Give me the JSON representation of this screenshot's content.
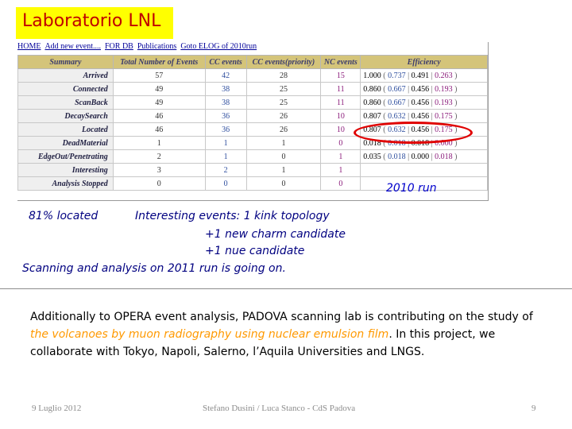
{
  "title": "Laboratorio LNL",
  "nav_links": [
    "HOME",
    "Add new event....",
    "FOR DB",
    "Publications",
    "Goto ELOG of 2010run"
  ],
  "table": {
    "headers": [
      "Summary",
      "Total Number of Events",
      "CC events",
      "CC events(priority)",
      "NC events",
      "Efficiency"
    ],
    "rows": [
      {
        "label": "Arrived",
        "total": "57",
        "cc": "42",
        "ccp": "28",
        "nc": "15",
        "eff_total": "1.000",
        "eff_cc": "0.737",
        "eff_ccp": "0.491",
        "eff_nc": "0.263"
      },
      {
        "label": "Connected",
        "total": "49",
        "cc": "38",
        "ccp": "25",
        "nc": "11",
        "eff_total": "0.860",
        "eff_cc": "0.667",
        "eff_ccp": "0.456",
        "eff_nc": "0.193"
      },
      {
        "label": "ScanBack",
        "total": "49",
        "cc": "38",
        "ccp": "25",
        "nc": "11",
        "eff_total": "0.860",
        "eff_cc": "0.667",
        "eff_ccp": "0.456",
        "eff_nc": "0.193"
      },
      {
        "label": "DecaySearch",
        "total": "46",
        "cc": "36",
        "ccp": "26",
        "nc": "10",
        "eff_total": "0.807",
        "eff_cc": "0.632",
        "eff_ccp": "0.456",
        "eff_nc": "0.175"
      },
      {
        "label": "Located",
        "total": "46",
        "cc": "36",
        "ccp": "26",
        "nc": "10",
        "eff_total": "0.807",
        "eff_cc": "0.632",
        "eff_ccp": "0.456",
        "eff_nc": "0.175"
      },
      {
        "label": "DeadMaterial",
        "total": "1",
        "cc": "1",
        "ccp": "1",
        "nc": "0",
        "eff_total": "0.018",
        "eff_cc": "0.018",
        "eff_ccp": "0.018",
        "eff_nc": "0.000"
      },
      {
        "label": "EdgeOut/Penetrating",
        "total": "2",
        "cc": "1",
        "ccp": "0",
        "nc": "1",
        "eff_total": "0.035",
        "eff_cc": "0.018",
        "eff_ccp": "0.000",
        "eff_nc": "0.018"
      },
      {
        "label": "Interesting",
        "total": "3",
        "cc": "2",
        "ccp": "1",
        "nc": "1",
        "eff_total": "",
        "eff_cc": "",
        "eff_ccp": "",
        "eff_nc": ""
      },
      {
        "label": "Analysis Stopped",
        "total": "0",
        "cc": "0",
        "ccp": "0",
        "nc": "0",
        "eff_total": "",
        "eff_cc": "",
        "eff_ccp": "",
        "eff_nc": ""
      }
    ]
  },
  "run_label": "2010 run",
  "located_note": "81% located",
  "interesting_lines": [
    "Interesting events: 1 kink topology",
    "+1 new charm candidate",
    "+1 nue candidate"
  ],
  "scanning_note": "Scanning and analysis on 2011 run is going on.",
  "paragraph": {
    "p1": "Additionally to OPERA event analysis, PADOVA scanning lab is contributing on the study of ",
    "highlight": "the volcanoes by muon radiography using nuclear emulsion film",
    "p2": ". In this project, we collaborate with Tokyo, Napoli, Salerno, l’Aquila Universities and LNGS."
  },
  "footer": {
    "date": "9 Luglio 2012",
    "authors": "Stefano Dusini / Luca Stanco - CdS Padova",
    "page": "9"
  },
  "colors": {
    "title_bg": "#ffff00",
    "title_text": "#c00000",
    "highlight": "#ff9900",
    "circle": "#e00000",
    "italic_notes": "#000080"
  }
}
